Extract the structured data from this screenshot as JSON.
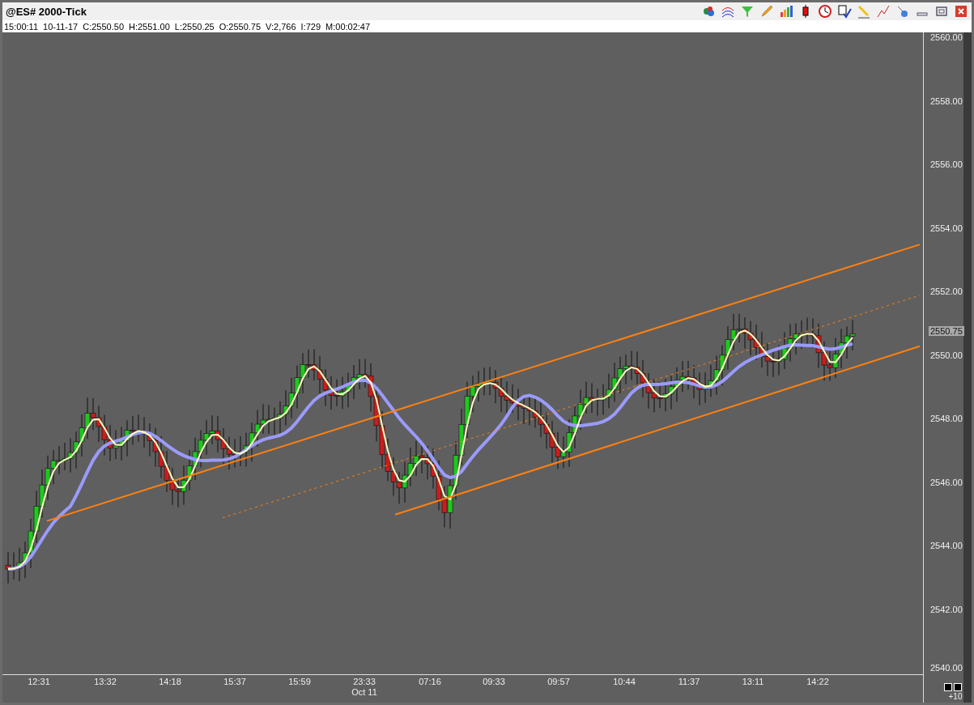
{
  "window": {
    "title": "@ES# 2000-Tick"
  },
  "status_line": [
    "15:00:11",
    "10-11-17",
    "C:2550.50",
    "H:2551.00",
    "L:2550.25",
    "O:2550.75",
    "V:2,766",
    "I:729",
    "M:00:02:47"
  ],
  "price_axis": {
    "labels": [
      "2560.00",
      "2558.00",
      "2556.00",
      "2554.00",
      "2552.00",
      "2550.00",
      "2548.00",
      "2546.00",
      "2544.00",
      "2542.00",
      "2540.00"
    ],
    "current_price": "2550.75"
  },
  "time_axis": {
    "labels": [
      "12:31",
      "13:32",
      "14:18",
      "15:37",
      "15:59",
      "23:33",
      "07:16",
      "09:33",
      "09:57",
      "10:44",
      "11:37",
      "13:11",
      "14:22"
    ],
    "date_label": "Oct 11",
    "offset": "+10"
  }
}
